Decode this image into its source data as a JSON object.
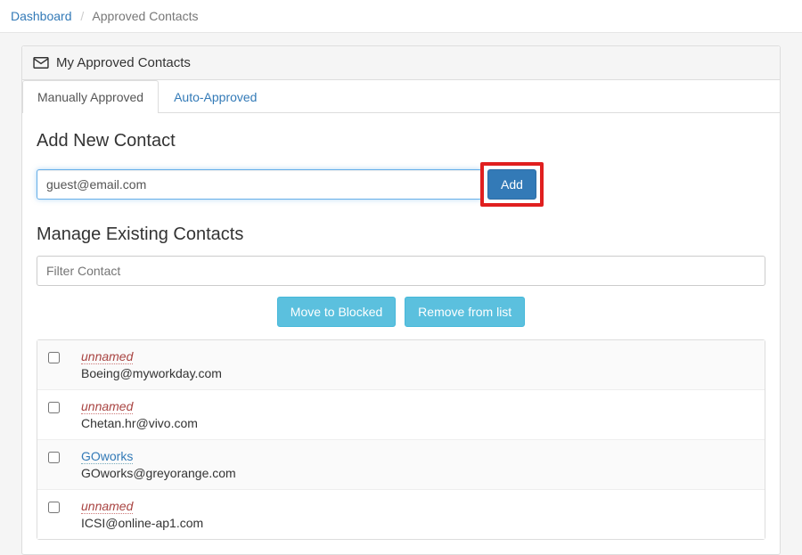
{
  "breadcrumb": {
    "root": "Dashboard",
    "current": "Approved Contacts"
  },
  "panel": {
    "title": "My Approved Contacts"
  },
  "tabs": {
    "manual": "Manually Approved",
    "auto": "Auto-Approved"
  },
  "add": {
    "heading": "Add New Contact",
    "input_value": "guest@email.com",
    "button": "Add"
  },
  "manage": {
    "heading": "Manage Existing Contacts",
    "filter_placeholder": "Filter Contact",
    "move_button": "Move to Blocked",
    "remove_button": "Remove from list"
  },
  "contacts": [
    {
      "name": "unnamed",
      "email": "Boeing@myworkday.com",
      "named": false
    },
    {
      "name": "unnamed",
      "email": "Chetan.hr@vivo.com",
      "named": false
    },
    {
      "name": "GOworks",
      "email": "GOworks@greyorange.com",
      "named": true
    },
    {
      "name": "unnamed",
      "email": "ICSI@online-ap1.com",
      "named": false
    }
  ]
}
